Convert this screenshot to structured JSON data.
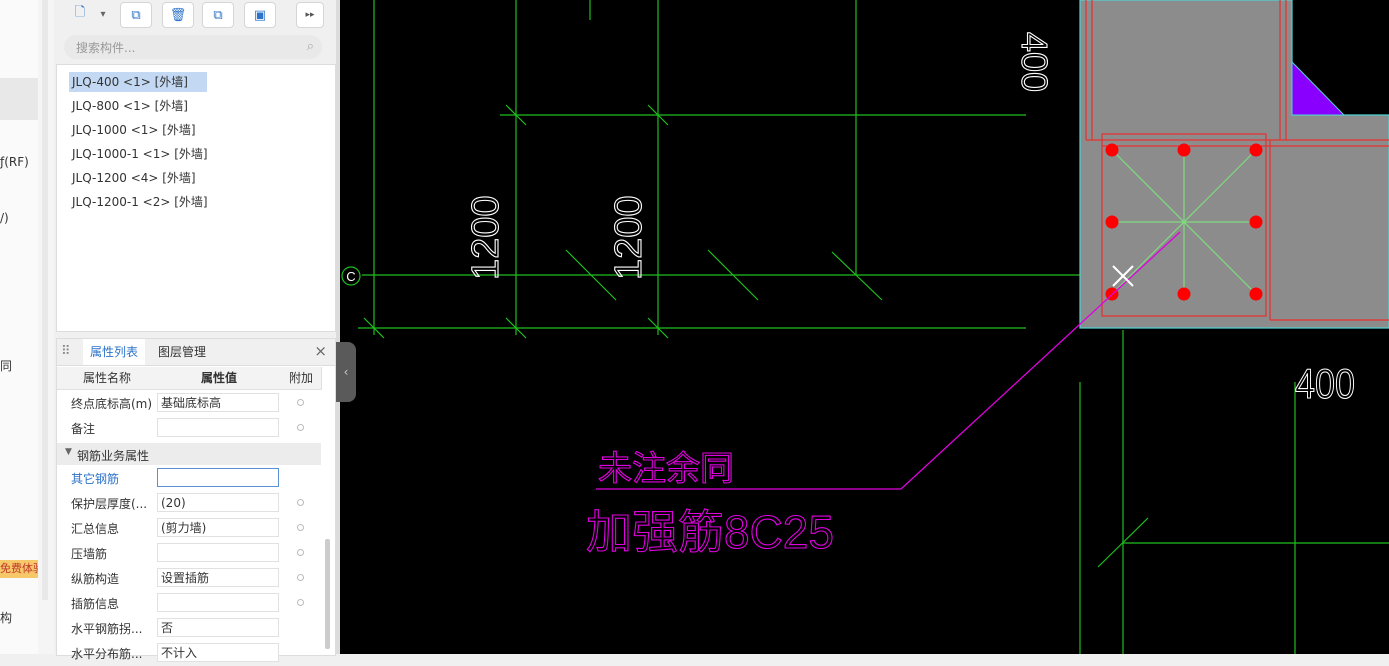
{
  "left_strip": {
    "items": [
      "ƒ(RF)",
      "/)",
      "同",
      "构"
    ],
    "badge": "免费体验"
  },
  "toolbar": {
    "buttons": [
      {
        "name": "new-component-button",
        "glyph": "🗋"
      },
      {
        "name": "dropdown-button",
        "glyph": "▾"
      },
      {
        "name": "copy-button",
        "glyph": "⧉"
      },
      {
        "name": "delete-button",
        "glyph": "🗑"
      },
      {
        "name": "duplicate-layer-button",
        "glyph": "⧉"
      },
      {
        "name": "save-as-button",
        "glyph": "▣"
      },
      {
        "name": "more-button",
        "glyph": "▸▸"
      }
    ]
  },
  "search": {
    "placeholder": "搜索构件..."
  },
  "components": [
    "JLQ-400 <1> [外墙]",
    "JLQ-800 <1> [外墙]",
    "JLQ-1000 <1> [外墙]",
    "JLQ-1000-1 <1> [外墙]",
    "JLQ-1200 <4> [外墙]",
    "JLQ-1200-1 <2> [外墙]"
  ],
  "props": {
    "tabs": [
      "属性列表",
      "图层管理"
    ],
    "columns": [
      "属性名称",
      "属性值",
      "附加"
    ],
    "rows": [
      {
        "name": "终点底标高(m)",
        "value": "基础底标高"
      },
      {
        "name": "备注",
        "value": ""
      }
    ],
    "group": "钢筋业务属性",
    "group_rows": [
      {
        "name": "其它钢筋",
        "value": ""
      },
      {
        "name": "保护层厚度(...",
        "value": "(20)"
      },
      {
        "name": "汇总信息",
        "value": "(剪力墙)"
      },
      {
        "name": "压墙筋",
        "value": ""
      },
      {
        "name": "纵筋构造",
        "value": "设置插筋"
      },
      {
        "name": "插筋信息",
        "value": ""
      },
      {
        "name": "水平钢筋拐...",
        "value": "否"
      },
      {
        "name": "水平分布筋...",
        "value": "不计入"
      }
    ]
  },
  "canvas": {
    "dim_a": "1200",
    "dim_b": "1200",
    "dim_top": "400",
    "dim_right": "400",
    "axis_label": "C",
    "note1": "未注余同",
    "note2": "加强筋8C25"
  }
}
